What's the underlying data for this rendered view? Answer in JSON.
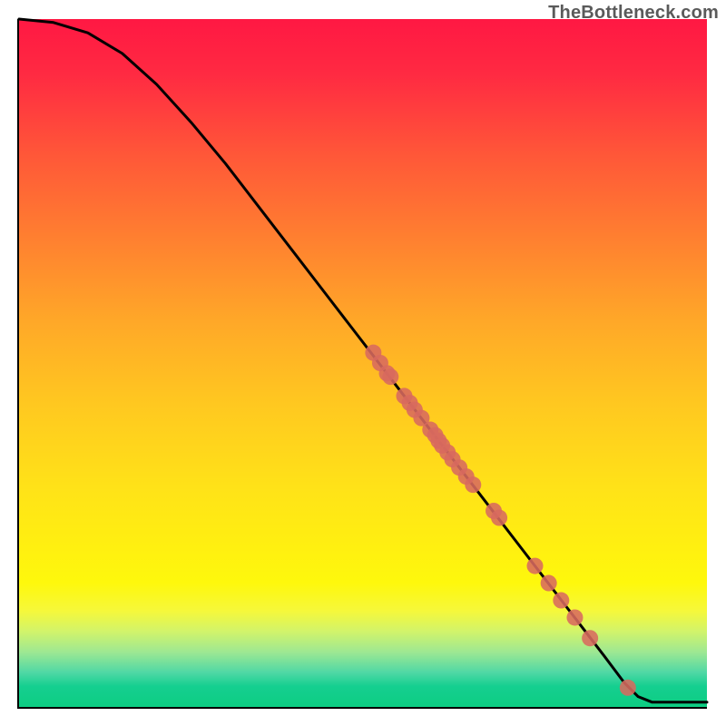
{
  "watermark": "TheBottleneck.com",
  "chart_data": {
    "type": "line",
    "title": "",
    "xlabel": "",
    "ylabel": "",
    "xlim": [
      0,
      100
    ],
    "ylim": [
      0,
      100
    ],
    "grid": false,
    "curve": [
      {
        "x": 0,
        "y": 100
      },
      {
        "x": 5,
        "y": 99.5
      },
      {
        "x": 10,
        "y": 98
      },
      {
        "x": 15,
        "y": 95
      },
      {
        "x": 20,
        "y": 90.5
      },
      {
        "x": 25,
        "y": 85
      },
      {
        "x": 30,
        "y": 79
      },
      {
        "x": 35,
        "y": 72.5
      },
      {
        "x": 40,
        "y": 66
      },
      {
        "x": 45,
        "y": 59.5
      },
      {
        "x": 50,
        "y": 53
      },
      {
        "x": 55,
        "y": 46.5
      },
      {
        "x": 60,
        "y": 40
      },
      {
        "x": 65,
        "y": 33.5
      },
      {
        "x": 70,
        "y": 27
      },
      {
        "x": 75,
        "y": 20.5
      },
      {
        "x": 80,
        "y": 14
      },
      {
        "x": 85,
        "y": 7.5
      },
      {
        "x": 88,
        "y": 3.5
      },
      {
        "x": 90,
        "y": 1.5
      },
      {
        "x": 92,
        "y": 0.7
      },
      {
        "x": 95,
        "y": 0.7
      },
      {
        "x": 100,
        "y": 0.7
      }
    ],
    "markers": [
      {
        "x": 51.5,
        "y": 51.5
      },
      {
        "x": 52.5,
        "y": 50.0
      },
      {
        "x": 53.5,
        "y": 48.5
      },
      {
        "x": 54.0,
        "y": 48.0
      },
      {
        "x": 56.0,
        "y": 45.2
      },
      {
        "x": 56.8,
        "y": 44.2
      },
      {
        "x": 57.5,
        "y": 43.2
      },
      {
        "x": 58.5,
        "y": 42.0
      },
      {
        "x": 59.8,
        "y": 40.3
      },
      {
        "x": 60.5,
        "y": 39.5
      },
      {
        "x": 61.0,
        "y": 38.7
      },
      {
        "x": 61.5,
        "y": 38.0
      },
      {
        "x": 62.3,
        "y": 37.0
      },
      {
        "x": 63.0,
        "y": 36.0
      },
      {
        "x": 64.0,
        "y": 34.8
      },
      {
        "x": 65.0,
        "y": 33.5
      },
      {
        "x": 66.0,
        "y": 32.3
      },
      {
        "x": 69.0,
        "y": 28.5
      },
      {
        "x": 69.8,
        "y": 27.5
      },
      {
        "x": 75.0,
        "y": 20.5
      },
      {
        "x": 77.0,
        "y": 18.0
      },
      {
        "x": 78.8,
        "y": 15.5
      },
      {
        "x": 80.8,
        "y": 13.0
      },
      {
        "x": 83.0,
        "y": 10.0
      },
      {
        "x": 88.5,
        "y": 2.8
      }
    ],
    "marker_color": "#d86a5f",
    "curve_color": "#000000"
  }
}
